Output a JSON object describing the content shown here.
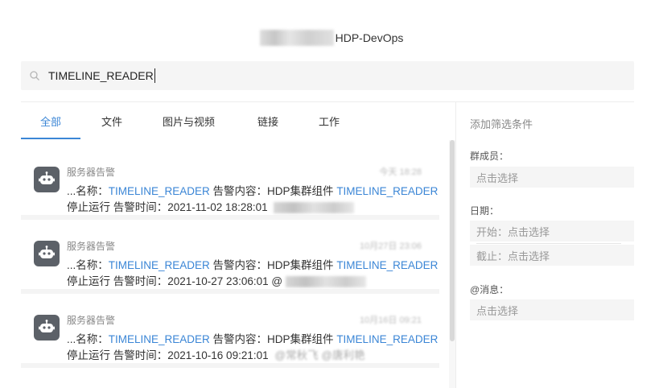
{
  "window": {
    "title": "HDP-DevOps"
  },
  "search": {
    "value": "TIMELINE_READER"
  },
  "tabs": [
    {
      "label": "全部",
      "active": true
    },
    {
      "label": "文件",
      "active": false
    },
    {
      "label": "图片与视频",
      "active": false
    },
    {
      "label": "链接",
      "active": false
    },
    {
      "label": "工作",
      "active": false
    }
  ],
  "results": [
    {
      "sender": "服务器告警",
      "line1_prefix": "...名称：",
      "line1_hl1": "TIMELINE_READER",
      "line1_mid": " 告警内容：HDP集群组件 ",
      "line1_hl2": "TIMELINE_READER",
      "line2": "停止运行 告警时间：2021-11-02 18:28:01 ",
      "time": "今天 18:28"
    },
    {
      "sender": "服务器告警",
      "line1_prefix": "...名称：",
      "line1_hl1": "TIMELINE_READER",
      "line1_mid": " 告警内容：HDP集群组件 ",
      "line1_hl2": "TIMELINE_READER",
      "line2": "停止运行 告警时间：2021-10-27 23:06:01 @",
      "time": "10月27日 23:06"
    },
    {
      "sender": "服务器告警",
      "line1_prefix": "...名称：",
      "line1_hl1": "TIMELINE_READER",
      "line1_mid": " 告警内容：HDP集群组件 ",
      "line1_hl2": "TIMELINE_READER",
      "line2": "停止运行 告警时间：2021-10-16 09:21:01 ",
      "line2_tail": "@常秋飞 @唐利艳",
      "time": "10月16日 09:21"
    }
  ],
  "filter": {
    "title": "添加筛选条件",
    "members_label": "群成员：",
    "members_placeholder": "点击选择",
    "date_label": "日期：",
    "date_start": "开始：点击选择",
    "date_end": "截止：点击选择",
    "mention_label": "@消息：",
    "mention_placeholder": "点击选择"
  },
  "colors": {
    "accent": "#3b86d6",
    "avatar": "#5c6168"
  },
  "icons": {
    "search": "search-icon",
    "avatar": "robot-icon"
  }
}
